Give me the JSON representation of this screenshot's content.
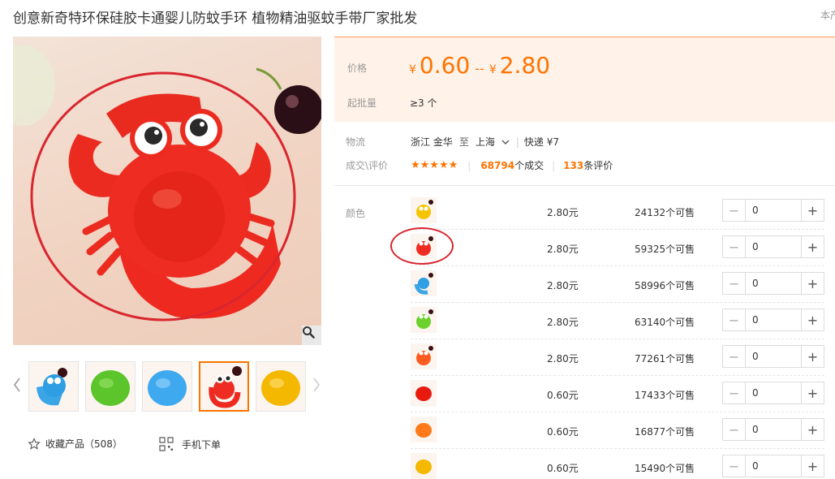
{
  "title": "创意新奇特环保硅胶卡通婴儿防蚊手环 植物精油驱蚊手带厂家批发",
  "side_link": "本产",
  "price": {
    "label": "价格",
    "currency": "¥",
    "min": "0.60",
    "sep": "--",
    "max": "2.80",
    "moq_label": "起批量",
    "moq_value": "≥3 个"
  },
  "logistics": {
    "label": "物流",
    "from": "浙江 金华",
    "to_word": "至",
    "to": "上海",
    "express": "快递 ¥7"
  },
  "deals": {
    "label": "成交\\评价",
    "stars": "★★★★★",
    "deal_count": "68794",
    "deal_unit": "个成交",
    "review_count": "133",
    "review_unit": "条评价"
  },
  "sku": {
    "color_label": "颜色",
    "rows": [
      {
        "price": "2.80元",
        "stock": "24132个可售",
        "qty": "0",
        "thumb": "yellow-bee"
      },
      {
        "price": "2.80元",
        "stock": "59325个可售",
        "qty": "0",
        "thumb": "red-crab"
      },
      {
        "price": "2.80元",
        "stock": "58996个可售",
        "qty": "0",
        "thumb": "blue-band"
      },
      {
        "price": "2.80元",
        "stock": "63140个可售",
        "qty": "0",
        "thumb": "green-frog"
      },
      {
        "price": "2.80元",
        "stock": "77261个可售",
        "qty": "0",
        "thumb": "orange-crab"
      },
      {
        "price": "0.60元",
        "stock": "17433个可售",
        "qty": "0",
        "thumb": "red-dome"
      },
      {
        "price": "0.60元",
        "stock": "16877个可售",
        "qty": "0",
        "thumb": "orange-dome"
      },
      {
        "price": "0.60元",
        "stock": "15490个可售",
        "qty": "0",
        "thumb": "yellow-dome"
      }
    ]
  },
  "gallery": {
    "thumbs": [
      "blue-band",
      "green-dome",
      "blue-dome",
      "red-crab",
      "yellow-dome"
    ],
    "active_index": 3
  },
  "actions": {
    "favorite_label": "收藏产品（508）",
    "mobile_label": "手机下单"
  },
  "colors": {
    "accent": "#ff7300",
    "highlight": "#d9262e",
    "panel_bg": "#fff2e8"
  }
}
